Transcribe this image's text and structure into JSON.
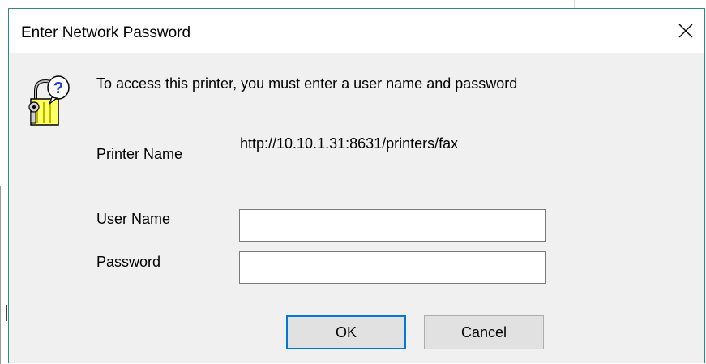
{
  "dialog": {
    "title": "Enter Network Password",
    "close_icon": "close-icon",
    "lock_icon": "lock-question-icon",
    "message": "To access this printer, you must enter a user name and password",
    "printer_name_label": "Printer Name",
    "printer_name_value": "http://10.10.1.31:8631/printers/fax",
    "user_name_label": "User Name",
    "user_name_value": "",
    "password_label": "Password",
    "password_value": "",
    "ok_label": "OK",
    "cancel_label": "Cancel"
  },
  "colors": {
    "accent": "#0078d7",
    "dialog_border": "#2c8a7e",
    "dialog_bg": "#f0f0f0",
    "button_bg": "#e1e1e1",
    "lock_yellow": "#ffff66",
    "lock_blue": "#1a3fd0"
  }
}
